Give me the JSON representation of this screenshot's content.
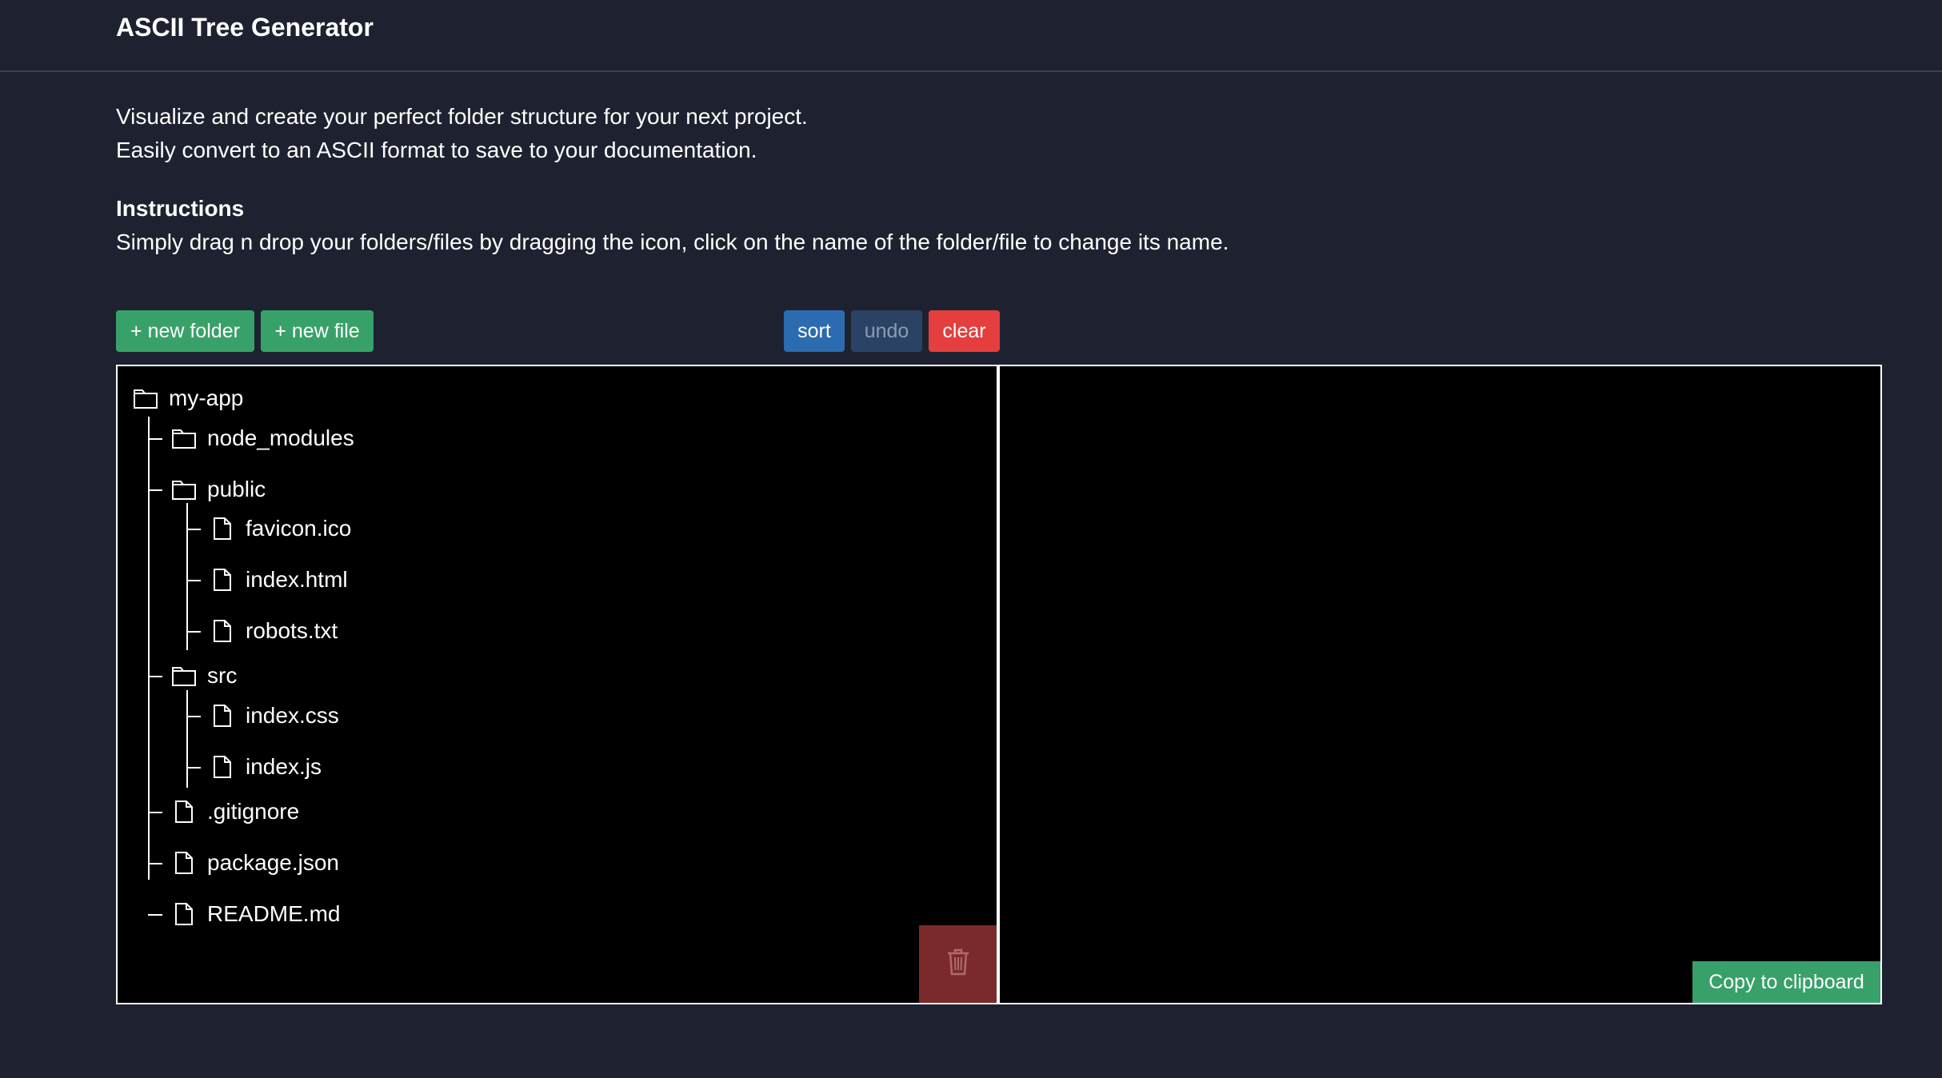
{
  "header": {
    "title": "ASCII Tree Generator"
  },
  "intro": {
    "line1": "Visualize and create your perfect folder structure for your next project.",
    "line2": "Easily convert to an ASCII format to save to your documentation."
  },
  "instructions": {
    "heading": "Instructions",
    "text": "Simply drag n drop your folders/files by dragging the icon, click on the name of the folder/file to change its name."
  },
  "toolbar": {
    "new_folder": "+ new folder",
    "new_file": "+ new file",
    "sort": "sort",
    "undo": "undo",
    "clear": "clear"
  },
  "tree": {
    "root": "my-app",
    "items": [
      {
        "name": "node_modules",
        "type": "folder"
      },
      {
        "name": "public",
        "type": "folder"
      },
      {
        "name": "favicon.ico",
        "type": "file"
      },
      {
        "name": "index.html",
        "type": "file"
      },
      {
        "name": "robots.txt",
        "type": "file"
      },
      {
        "name": "src",
        "type": "folder"
      },
      {
        "name": "index.css",
        "type": "file"
      },
      {
        "name": "index.js",
        "type": "file"
      },
      {
        "name": ".gitignore",
        "type": "file"
      },
      {
        "name": "package.json",
        "type": "file"
      },
      {
        "name": "README.md",
        "type": "file"
      }
    ]
  },
  "output": {
    "copy_label": "Copy to clipboard"
  },
  "colors": {
    "background": "#1e2230",
    "green": "#38a169",
    "blue": "#2b6cb0",
    "red": "#e53e3e",
    "undo": "#2a4365",
    "trash": "#7a2a2a"
  },
  "icons": {
    "folder": "folder-icon",
    "file": "file-icon",
    "trash": "trash-icon"
  }
}
